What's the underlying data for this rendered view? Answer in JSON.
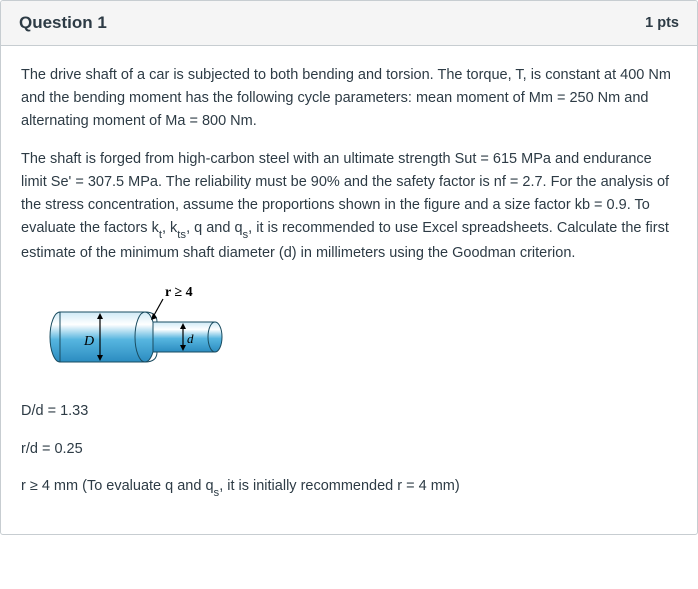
{
  "header": {
    "title": "Question 1",
    "points": "1 pts"
  },
  "para1": "The drive shaft of a car is subjected to both bending and torsion. The torque, T, is constant at 400 Nm and the bending moment has the following cycle parameters: mean moment of Mm = 250 Nm and alternating moment of Ma = 800 Nm.",
  "para2_parts": {
    "a": "The shaft is forged from high-carbon steel with an ultimate strength Sut = 615 MPa and endurance limit Se' = 307.5 MPa. The reliability must be 90% and the safety factor is nf = 2.7. For the analysis of the stress concentration, assume the proportions shown in the figure and a size factor kb = 0.9. To evaluate the factors k",
    "t": "t",
    "b": ", k",
    "ts": "ts",
    "c": ", q and q",
    "s": "s",
    "d": ", it is recommended to use Excel spreadsheets. Calculate the first estimate of the minimum shaft diameter (d) in millimeters using the Goodman criterion."
  },
  "figure": {
    "r_label": "r ≥ 4",
    "D_label": "D",
    "d_label": "d"
  },
  "specs": {
    "ratio1": "D/d = 1.33",
    "ratio2": "r/d = 0.25",
    "r_note_a": "r ≥ 4 mm (To evaluate q and q",
    "r_note_s": "s",
    "r_note_b": ", it is initially recommended r = 4 mm)"
  }
}
